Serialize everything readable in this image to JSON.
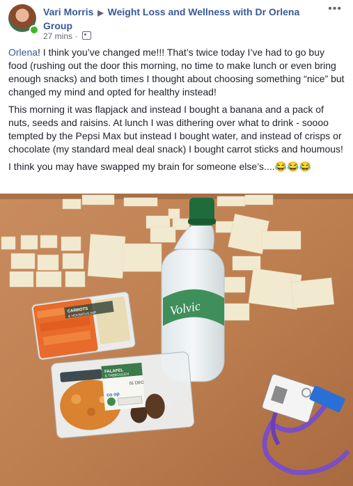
{
  "post": {
    "author": "Vari Morris",
    "group_name": "Weight Loss and Wellness with Dr Orlena Group",
    "timestamp": "27 mins",
    "separator": "·",
    "audience_icon": "group-audience-icon",
    "more_icon": "•••",
    "paragraph1_mention": "Orlena",
    "paragraph1_rest": "! I think you’ve changed me!!! That’s twice today I’ve had to go buy food (rushing out the door this morning, no time to make lunch or even bring enough snacks) and both times I thought about choosing something “nice” but changed my mind and opted for healthy instead!",
    "paragraph2": "This morning it was flapjack and instead I bought a banana and a pack of nuts, seeds and raisins. At lunch I was dithering over what to drink - soooo tempted by the Pepsi Max but instead I bought water, and instead of crisps or chocolate (my standard meal deal snack) I bought carrot sticks and houmous!",
    "paragraph3": "I think you may have swapped my brain for someone else’s....😂😂😂"
  },
  "photo": {
    "bottle_label": "Volvic",
    "carrot_label_line1": "CARROTS",
    "carrot_label_line2": "& HOUMOUS DIP",
    "salad_label_line1": "FALAFEL",
    "salad_label_line2": "& TABBOULEH",
    "salad_date": "01 DEC",
    "brand": "co op"
  },
  "colors": {
    "link": "#385898",
    "text": "#1d2129",
    "meta": "#606770",
    "table": "#c9885a",
    "lanyard": "#7a4fc4"
  }
}
